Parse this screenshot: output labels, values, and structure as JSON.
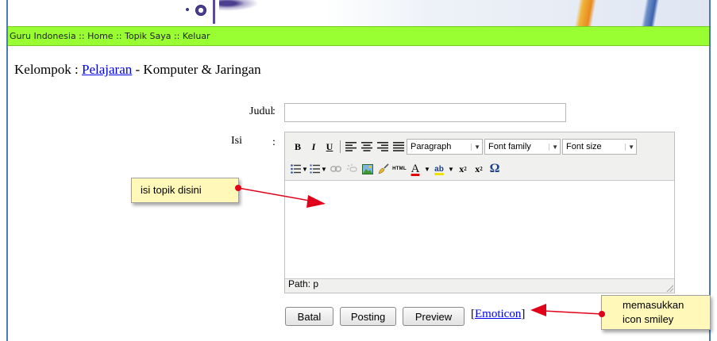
{
  "nav": {
    "items": [
      "Guru Indonesia",
      "Home",
      "Topik Saya",
      "Keluar"
    ],
    "separator": " :: "
  },
  "heading": {
    "prefix": "Kelompok :",
    "link": "Pelajaran",
    "suffix": "- Komputer & Jaringan"
  },
  "form": {
    "judul_label": "Judul",
    "judul_colon": ":",
    "judul_value": "",
    "isi_label": "Isi",
    "isi_colon": ":"
  },
  "editor": {
    "format_select": "Paragraph",
    "font_family_select": "Font family",
    "font_size_select": "Font size",
    "bold": "B",
    "italic": "I",
    "underline": "U",
    "html_label": "HTML",
    "font_color": "A",
    "highlight": "ab",
    "subscript": "x",
    "sub_mark": "2",
    "superscript": "x",
    "sup_mark": "2",
    "omega": "Ω",
    "status_path": "Path: p"
  },
  "buttons": {
    "batal": "Batal",
    "posting": "Posting",
    "preview": "Preview",
    "emoticon_open": "[",
    "emoticon_link": "Emoticon",
    "emoticon_close": "]"
  },
  "annotations": {
    "left_note": "isi topik disini",
    "right_note_line1": "memasukkan",
    "right_note_line2": "icon smiley"
  },
  "colors": {
    "navbar": "#99ff33",
    "link": "#0000ee",
    "callout": "#fff8b8",
    "arrow": "#e0001a"
  }
}
